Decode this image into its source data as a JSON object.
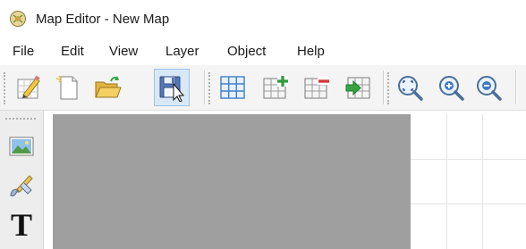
{
  "window": {
    "title": "Map Editor - New Map",
    "app_icon": "map-editor-app-icon"
  },
  "menubar": {
    "items": [
      "File",
      "Edit",
      "View",
      "Layer",
      "Object",
      "Help"
    ]
  },
  "toolbar": {
    "tools": [
      {
        "icon": "edit-map-properties-icon"
      },
      {
        "icon": "new-file-icon"
      },
      {
        "icon": "open-folder-icon"
      },
      {
        "icon": "save-disk-icon",
        "state": "hovered"
      },
      {
        "icon": "grid-icon"
      },
      {
        "icon": "add-row-column-icon"
      },
      {
        "icon": "remove-row-column-icon"
      },
      {
        "icon": "insert-arrow-grid-icon"
      },
      {
        "icon": "zoom-fit-icon"
      },
      {
        "icon": "zoom-in-icon"
      },
      {
        "icon": "zoom-out-icon"
      }
    ]
  },
  "left_tools": {
    "items": [
      {
        "icon": "image-picture-icon"
      },
      {
        "icon": "paint-brush-icon"
      },
      {
        "icon": "text-tool-icon",
        "glyph": "T"
      }
    ]
  },
  "canvas": {
    "map_color": "#9f9f9f",
    "grid_color": "#e4e4e4"
  },
  "colors": {
    "hover_bg": "#d8e8f7",
    "hover_border": "#9cc3e8",
    "toolbar_bg": "#f4f4f4"
  }
}
